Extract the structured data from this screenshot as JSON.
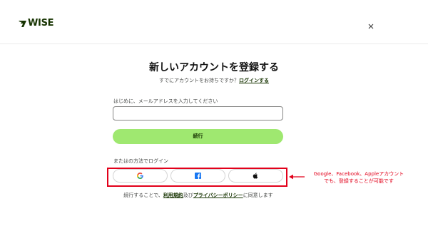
{
  "header": {
    "logo_text": "WISE",
    "logo_icon": "wise-flag-logo",
    "close_icon": "close-x-icon"
  },
  "signup": {
    "title": "新しいアカウントを登録する",
    "have_account_text": "すでにアカウントをお持ちですか？",
    "login_link": "ログインする",
    "email_label": "はじめに、メールアドレスを入力してください",
    "email_value": "",
    "continue_button": "続行",
    "other_methods_label": "またはの方法でログイン",
    "social": {
      "google_icon": "google-icon",
      "facebook_icon": "facebook-icon",
      "apple_icon": "apple-icon"
    },
    "terms_prefix": "続行することで、",
    "terms_link": "利用規約",
    "terms_and": "及び",
    "privacy_link": "プライバシーポリシー",
    "terms_suffix": "に同意します"
  },
  "annotation": {
    "line1": "Google、Facebook、Appleアカウント",
    "line2": "でも、登録することが可能です",
    "color": "#e2001a"
  },
  "colors": {
    "brand_green": "#9fe870",
    "brand_dark": "#163300"
  }
}
